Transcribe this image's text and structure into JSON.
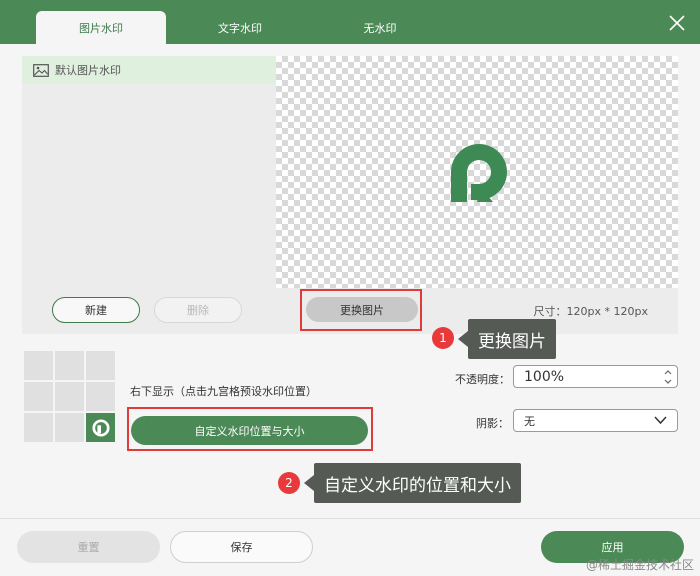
{
  "tabs": [
    {
      "label": "图片水印",
      "active": true
    },
    {
      "label": "文字水印",
      "active": false
    },
    {
      "label": "无水印",
      "active": false
    }
  ],
  "list": {
    "items": [
      {
        "label": "默认图片水印",
        "icon": "image-icon"
      }
    ],
    "new_label": "新建",
    "delete_label": "删除"
  },
  "preview": {
    "change_label": "更换图片",
    "size_text": "尺寸：120px * 120px"
  },
  "annotations": [
    {
      "number": "1",
      "text": "更换图片"
    },
    {
      "number": "2",
      "text": "自定义水印的位置和大小"
    }
  ],
  "position": {
    "selected_text": "右下显示（点击九宫格预设水印位置）",
    "custom_label": "自定义水印位置与大小"
  },
  "settings": {
    "opacity_label": "不透明度：",
    "opacity_value": "100%",
    "shadow_label": "阴影：",
    "shadow_value": "无"
  },
  "footer": {
    "reset_label": "重置",
    "save_label": "保存",
    "apply_label": "应用"
  },
  "watermark_text": "@稀土掘金技术社区",
  "colors": {
    "accent": "#4b8a57",
    "highlight": "#e03a3a"
  }
}
